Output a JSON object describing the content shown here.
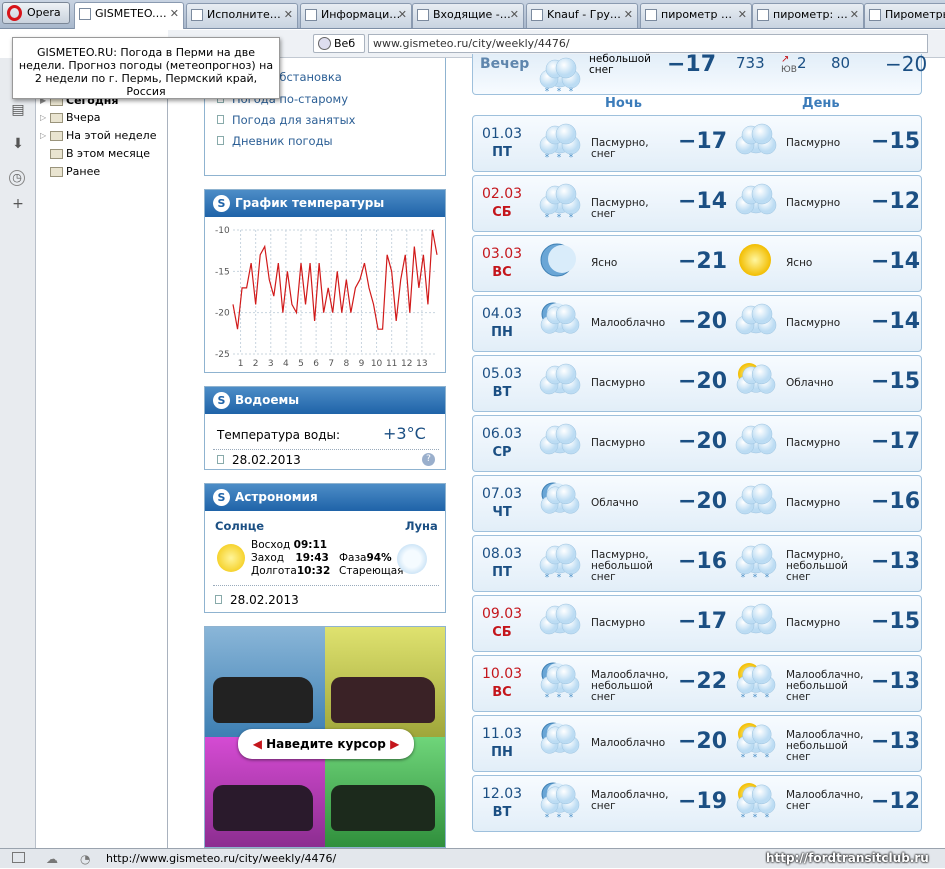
{
  "browser": {
    "opera_label": "Opera",
    "tabs": [
      {
        "label": "GISMETEO.…",
        "active": true
      },
      {
        "label": "Исполните…"
      },
      {
        "label": "Информаци…"
      },
      {
        "label": "Входящие -…"
      },
      {
        "label": "Knauf - Гру…"
      },
      {
        "label": "пирометр …"
      },
      {
        "label": "пирометр: …"
      },
      {
        "label": "Пирометры…"
      }
    ],
    "web_label": "Веб",
    "url": "www.gismeteo.ru/city/weekly/4476/",
    "tooltip": "GISMETEO.RU: Погода в Перми на две недели. Прогноз погоды (метеопрогноз) на 2 недели по г. Пермь, Пермский край, Россия",
    "status_url": "http://www.gismeteo.ru/city/weekly/4476/",
    "watermark": "http://fordtransitclub.ru"
  },
  "history": {
    "items": [
      "Сегодня",
      "Вчера",
      "На этой неделе",
      "В этом месяце",
      "Ранее"
    ]
  },
  "menu": {
    "items": [
      "итная обстановка",
      "Погода по-старому",
      "Погода для занятых",
      "Дневник погоды"
    ]
  },
  "temp_graph": {
    "title": "График температуры",
    "y_ticks": [
      "-10",
      "-15",
      "-20",
      "-25"
    ],
    "x_ticks": [
      "1",
      "2",
      "3",
      "4",
      "5",
      "6",
      "7",
      "8",
      "9",
      "10",
      "11",
      "12",
      "13"
    ]
  },
  "chart_data": {
    "type": "line",
    "title": "График температуры",
    "ylim": [
      -25,
      -10
    ],
    "xlim": [
      0.5,
      14
    ],
    "grid": true,
    "x": [
      0.5,
      0.8,
      1.1,
      1.4,
      1.7,
      2.0,
      2.3,
      2.6,
      2.9,
      3.2,
      3.5,
      3.8,
      4.1,
      4.4,
      4.7,
      5.0,
      5.3,
      5.6,
      5.9,
      6.2,
      6.5,
      6.8,
      7.1,
      7.4,
      7.7,
      8.0,
      8.3,
      8.6,
      8.9,
      9.2,
      9.5,
      9.8,
      10.1,
      10.4,
      10.7,
      11.0,
      11.3,
      11.6,
      11.9,
      12.2,
      12.5,
      12.8,
      13.1,
      13.4,
      13.7,
      14.0
    ],
    "values": [
      -19,
      -22,
      -17,
      -17,
      -14,
      -19,
      -13,
      -12,
      -16,
      -18,
      -14,
      -20,
      -15,
      -19,
      -20,
      -14,
      -19,
      -14,
      -21,
      -14,
      -20,
      -17,
      -20,
      -15,
      -20,
      -16,
      -20,
      -17,
      -16,
      -14,
      -17,
      -19,
      -22,
      -22,
      -13,
      -15,
      -21,
      -16,
      -13,
      -20,
      -12,
      -17,
      -13,
      -19,
      -10,
      -13
    ]
  },
  "water": {
    "title": "Водоемы",
    "label": "Температура воды:",
    "value": "+3°C",
    "date": "28.02.2013"
  },
  "astro": {
    "title": "Астрономия",
    "sun_label": "Солнце",
    "moon_label": "Луна",
    "rise_label": "Восход",
    "rise": "09:11",
    "set_label": "Заход",
    "set": "19:43",
    "len_label": "Долгота",
    "len": "10:32",
    "phase_label": "Фаза",
    "phase": "94%",
    "phase_state": "Стареющая",
    "date": "28.02.2013"
  },
  "ad": {
    "text": "Наведите курсор"
  },
  "forecast": {
    "top_row": {
      "label": "Вечер",
      "desc": "небольшой снег",
      "temp": "−17",
      "pressure": "733",
      "wind_dir": "ЮВ",
      "wind": "2",
      "humidity": "80",
      "feels": "−20"
    },
    "night_label": "Ночь",
    "day_label": "День",
    "rows": [
      {
        "date": "01.03",
        "dow": "ПТ",
        "weekend": false,
        "n_desc": "Пасмурно, снег",
        "n_temp": "−17",
        "n_icon": "cloud-snow",
        "d_desc": "Пасмурно",
        "d_temp": "−15",
        "d_icon": "cloud"
      },
      {
        "date": "02.03",
        "dow": "СБ",
        "weekend": true,
        "n_desc": "Пасмурно, снег",
        "n_temp": "−14",
        "n_icon": "cloud-snow",
        "d_desc": "Пасмурно",
        "d_temp": "−12",
        "d_icon": "cloud"
      },
      {
        "date": "03.03",
        "dow": "ВС",
        "weekend": true,
        "n_desc": "Ясно",
        "n_temp": "−21",
        "n_icon": "moon",
        "d_desc": "Ясно",
        "d_temp": "−14",
        "d_icon": "sun"
      },
      {
        "date": "04.03",
        "dow": "ПН",
        "weekend": false,
        "n_desc": "Малооблачно",
        "n_temp": "−20",
        "n_icon": "moon-cloud",
        "d_desc": "Пасмурно",
        "d_temp": "−14",
        "d_icon": "cloud"
      },
      {
        "date": "05.03",
        "dow": "ВТ",
        "weekend": false,
        "n_desc": "Пасмурно",
        "n_temp": "−20",
        "n_icon": "cloud",
        "d_desc": "Облачно",
        "d_temp": "−15",
        "d_icon": "sun-cloud"
      },
      {
        "date": "06.03",
        "dow": "СР",
        "weekend": false,
        "n_desc": "Пасмурно",
        "n_temp": "−20",
        "n_icon": "cloud",
        "d_desc": "Пасмурно",
        "d_temp": "−17",
        "d_icon": "cloud"
      },
      {
        "date": "07.03",
        "dow": "ЧТ",
        "weekend": false,
        "n_desc": "Облачно",
        "n_temp": "−20",
        "n_icon": "moon-cloud",
        "d_desc": "Пасмурно",
        "d_temp": "−16",
        "d_icon": "cloud"
      },
      {
        "date": "08.03",
        "dow": "ПТ",
        "weekend": false,
        "n_desc": "Пасмурно, небольшой снег",
        "n_temp": "−16",
        "n_icon": "cloud-snow",
        "d_desc": "Пасмурно, небольшой снег",
        "d_temp": "−13",
        "d_icon": "cloud-snow"
      },
      {
        "date": "09.03",
        "dow": "СБ",
        "weekend": true,
        "n_desc": "Пасмурно",
        "n_temp": "−17",
        "n_icon": "cloud",
        "d_desc": "Пасмурно",
        "d_temp": "−15",
        "d_icon": "cloud"
      },
      {
        "date": "10.03",
        "dow": "ВС",
        "weekend": true,
        "n_desc": "Малооблачно, небольшой снег",
        "n_temp": "−22",
        "n_icon": "moon-cloud-snow",
        "d_desc": "Малооблачно, небольшой снег",
        "d_temp": "−13",
        "d_icon": "sun-cloud-snow"
      },
      {
        "date": "11.03",
        "dow": "ПН",
        "weekend": false,
        "n_desc": "Малооблачно",
        "n_temp": "−20",
        "n_icon": "moon-cloud",
        "d_desc": "Малооблачно, небольшой снег",
        "d_temp": "−13",
        "d_icon": "sun-cloud-snow"
      },
      {
        "date": "12.03",
        "dow": "ВТ",
        "weekend": false,
        "n_desc": "Малооблачно, снег",
        "n_temp": "−19",
        "n_icon": "moon-cloud-snow",
        "d_desc": "Малооблачно, снег",
        "d_temp": "−12",
        "d_icon": "sun-cloud-snow"
      }
    ]
  }
}
